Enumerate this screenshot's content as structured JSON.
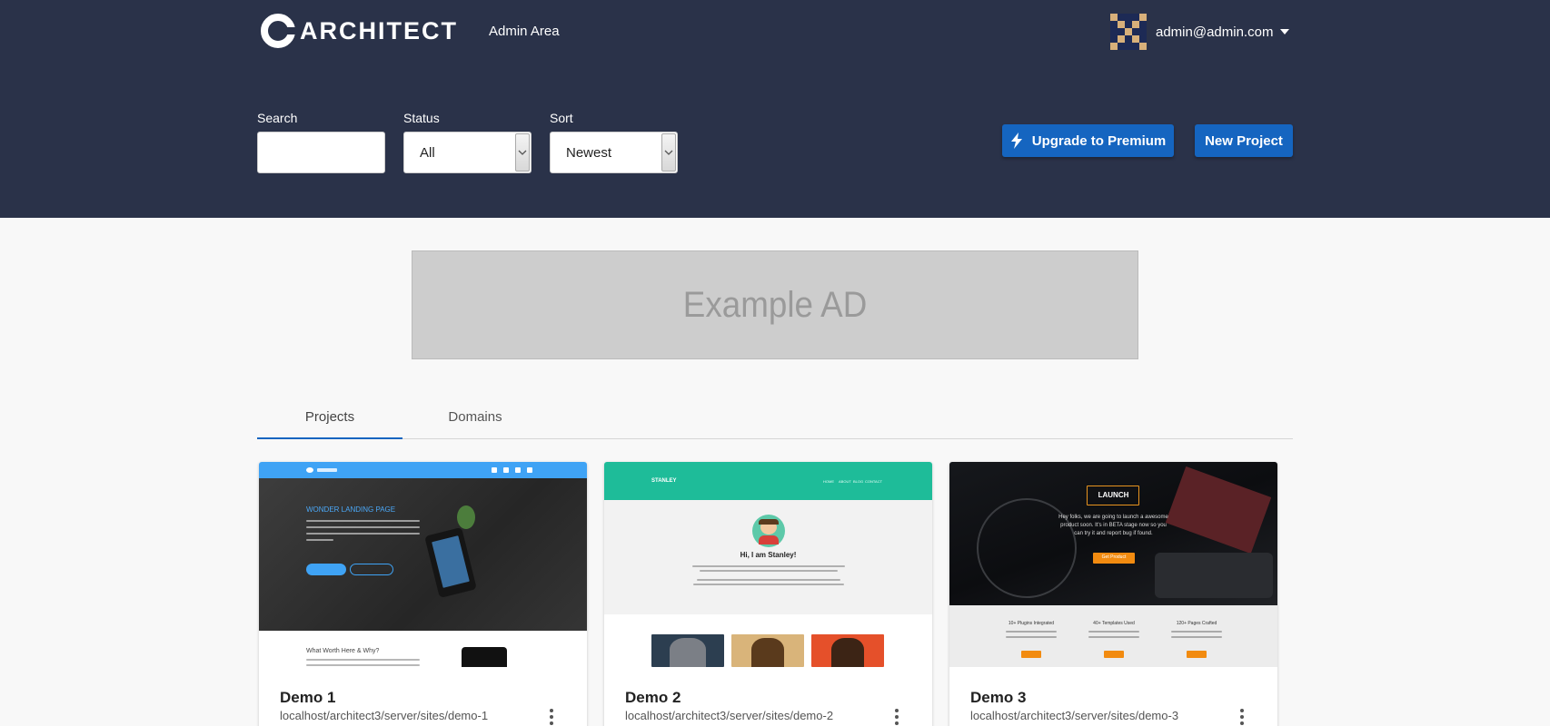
{
  "header": {
    "brand": "ARCHITECT",
    "subtitle": "Admin Area",
    "user_email": "admin@admin.com"
  },
  "filters": {
    "search_label": "Search",
    "search_value": "",
    "status_label": "Status",
    "status_value": "All",
    "sort_label": "Sort",
    "sort_value": "Newest"
  },
  "actions": {
    "upgrade_label": "Upgrade to Premium",
    "new_project_label": "New Project"
  },
  "ad": {
    "text": "Example AD"
  },
  "tabs": [
    {
      "label": "Projects",
      "active": true
    },
    {
      "label": "Domains",
      "active": false
    }
  ],
  "projects": [
    {
      "name": "Demo 1",
      "url": "localhost/architect3/server/sites/demo-1",
      "thumb": {
        "headline": "WONDER LANDING PAGE",
        "section": "What Worth Here & Why?"
      }
    },
    {
      "name": "Demo 2",
      "url": "localhost/architect3/server/sites/demo-2",
      "thumb": {
        "brand": "STANLEY",
        "nav": [
          "HOME",
          "ABOUT",
          "BLOG",
          "CONTACT"
        ],
        "heading": "Hi, I am Stanley!"
      }
    },
    {
      "name": "Demo 3",
      "url": "localhost/architect3/server/sites/demo-3",
      "thumb": {
        "badge": "LAUNCH",
        "line1": "Hey folks, we are going to launch a awesome",
        "line2": "product soon. It's in BETA stage now so you",
        "line3": "can try it and report bug if found.",
        "cta": "Get Product",
        "stats": [
          "10+ Plugins Integrated",
          "40+ Templates Used",
          "120+ Pages Crafted"
        ]
      }
    }
  ],
  "colors": {
    "header_bg": "#2a3249",
    "accent": "#1565c0",
    "teal": "#1ebc99"
  }
}
